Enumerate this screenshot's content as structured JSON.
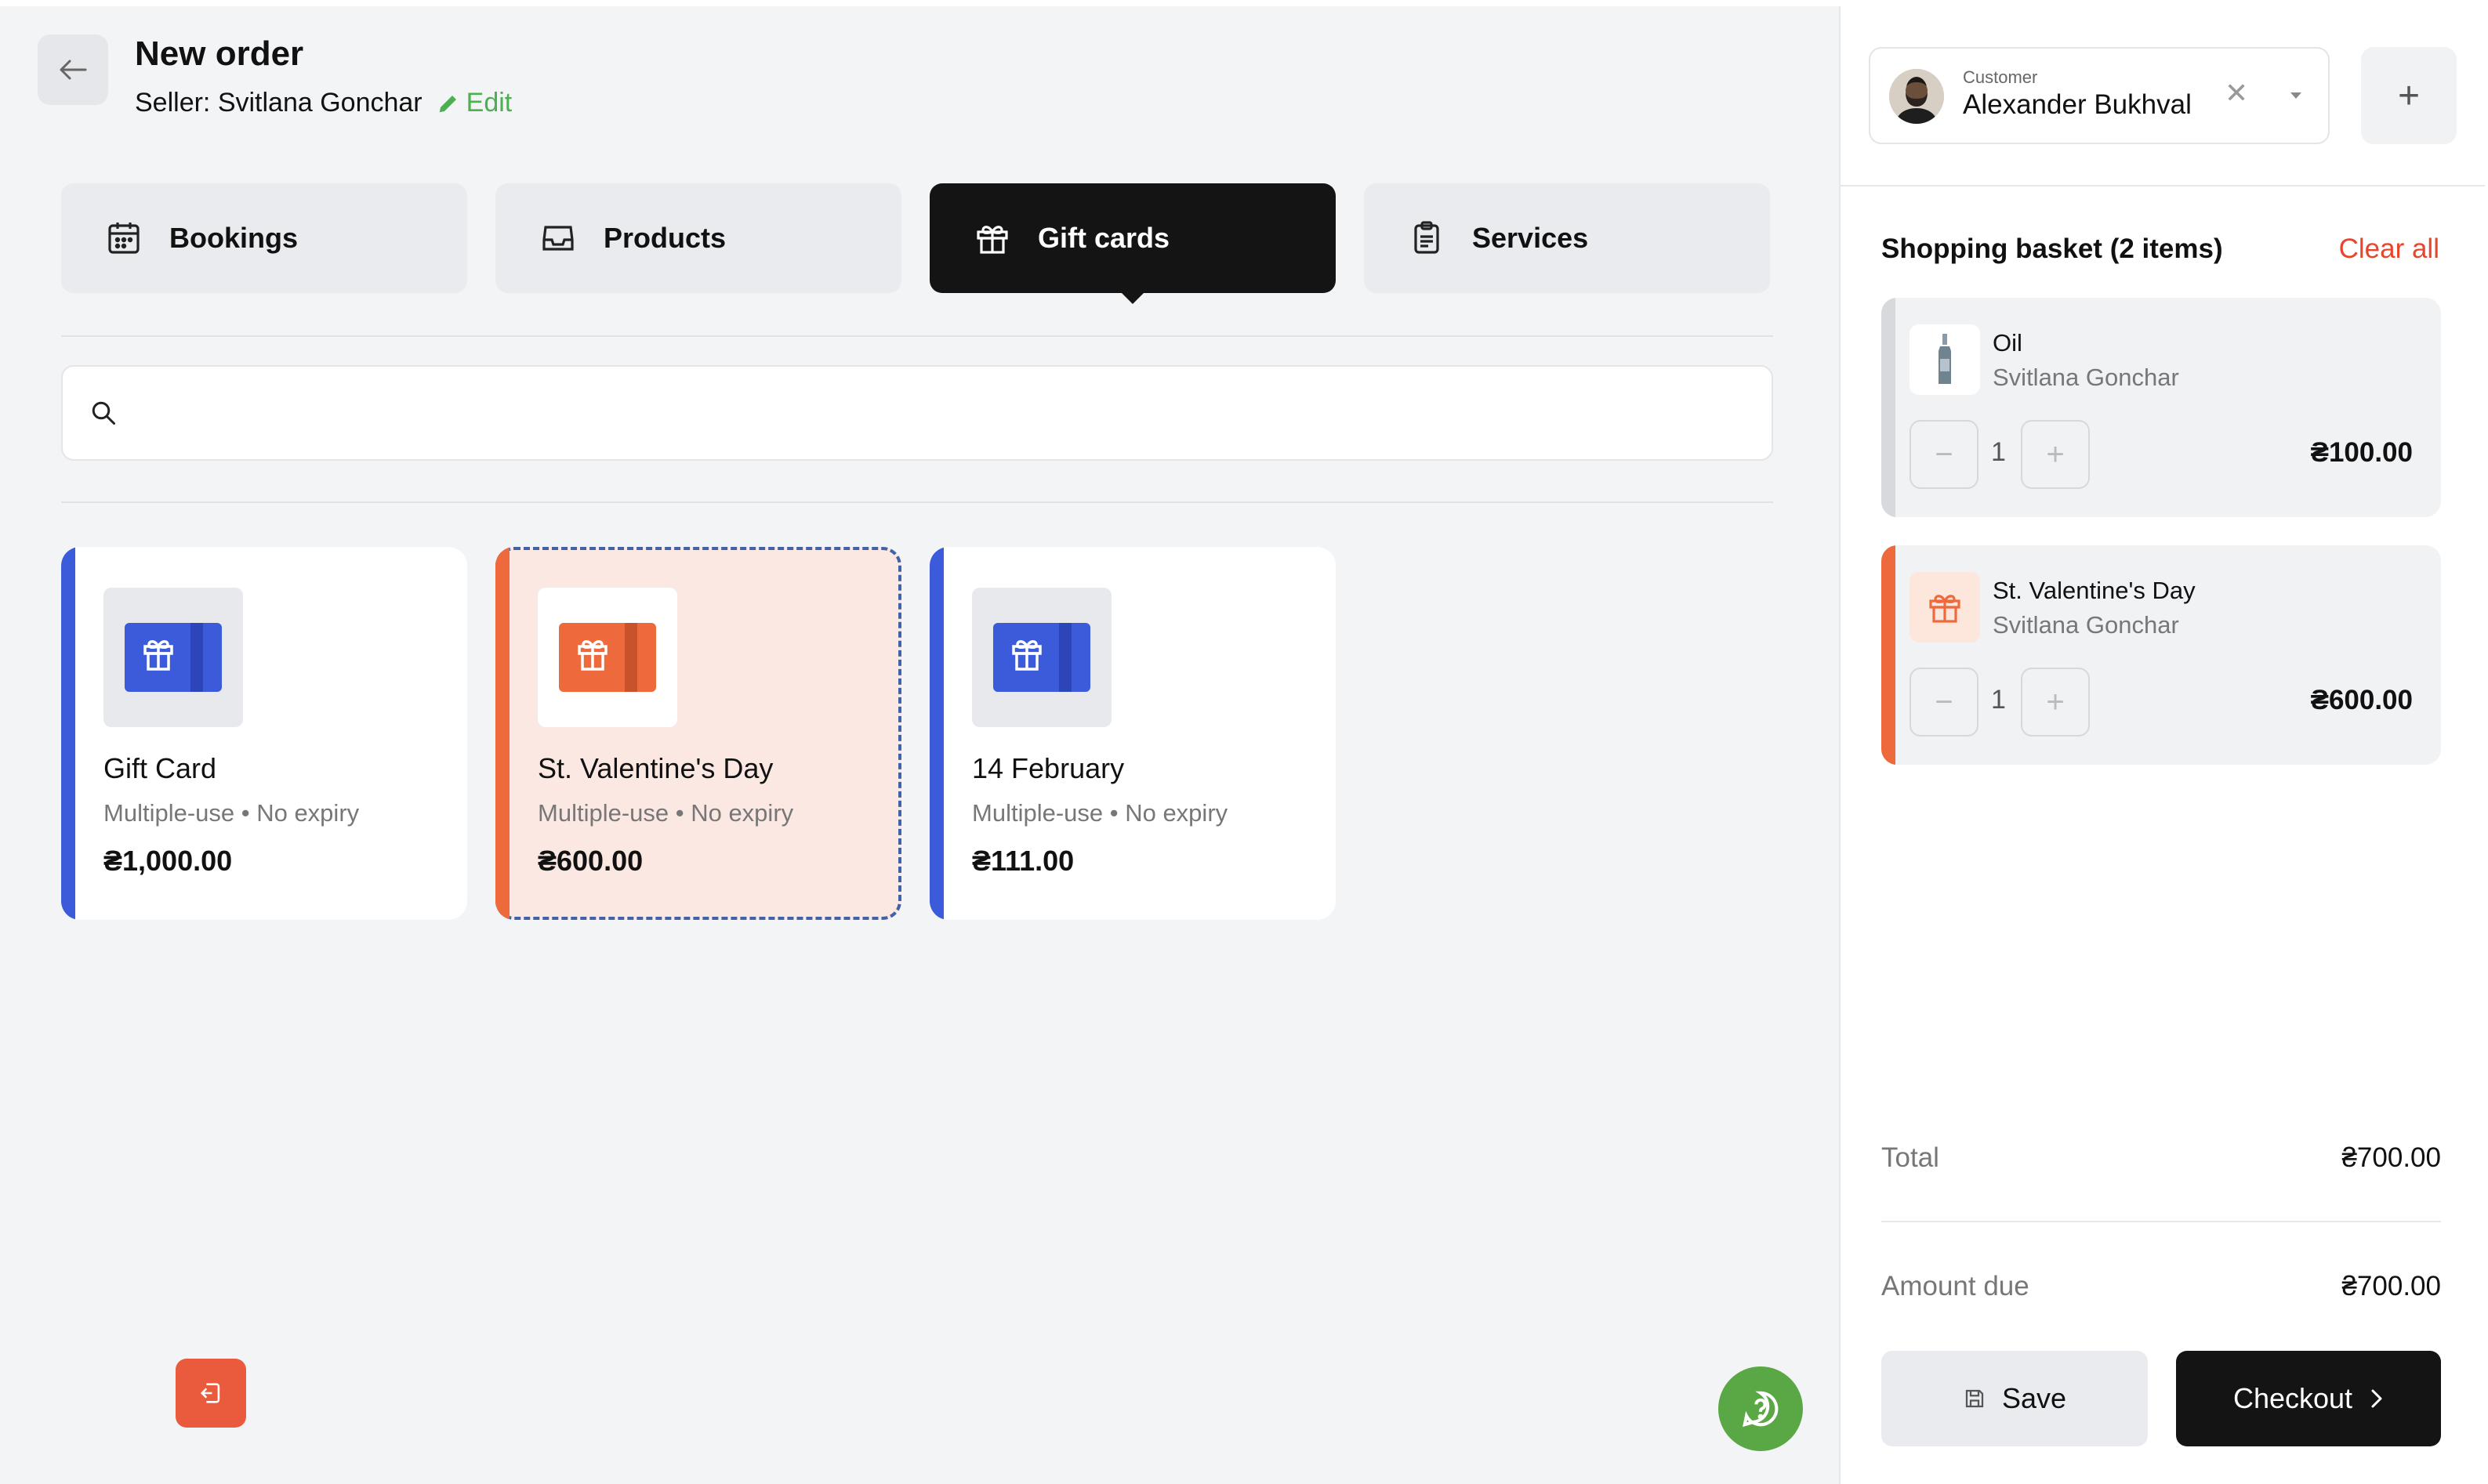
{
  "header": {
    "title": "New order",
    "seller_label": "Seller: Svitlana Gonchar",
    "edit_label": "Edit"
  },
  "tabs": [
    {
      "label": "Bookings",
      "icon": "calendar-icon",
      "active": false
    },
    {
      "label": "Products",
      "icon": "inbox-icon",
      "active": false
    },
    {
      "label": "Gift cards",
      "icon": "gift-icon",
      "active": true
    },
    {
      "label": "Services",
      "icon": "clipboard-icon",
      "active": false
    }
  ],
  "search": {
    "placeholder": "",
    "value": ""
  },
  "gift_cards": [
    {
      "name": "Gift Card",
      "meta": "Multiple-use • No expiry",
      "price": "₴1,000.00",
      "color": "#3b5bdb",
      "selected": false
    },
    {
      "name": "St. Valentine's Day",
      "meta": "Multiple-use • No expiry",
      "price": "₴600.00",
      "color": "#ee6a3d",
      "selected": true
    },
    {
      "name": "14 February",
      "meta": "Multiple-use • No expiry",
      "price": "₴111.00",
      "color": "#3b5bdb",
      "selected": false
    }
  ],
  "customer": {
    "label": "Customer",
    "name": "Alexander Bukhval",
    "clear_symbol": "✕",
    "add_symbol": "+"
  },
  "basket": {
    "title": "Shopping basket (2 items)",
    "clear_all_label": "Clear all",
    "items": [
      {
        "name": "Oil",
        "seller": "Svitlana Gonchar",
        "qty": "1",
        "price": "₴100.00",
        "stripe_color": "#d7d9dd",
        "icon": "bottle-icon"
      },
      {
        "name": "St. Valentine's Day",
        "seller": "Svitlana Gonchar",
        "qty": "1",
        "price": "₴600.00",
        "stripe_color": "#ee6a3d",
        "icon": "gift-icon"
      }
    ]
  },
  "totals": {
    "total_label": "Total",
    "total_value": "₴700.00",
    "due_label": "Amount due",
    "due_value": "₴700.00"
  },
  "actions": {
    "save_label": "Save",
    "checkout_label": "Checkout"
  }
}
